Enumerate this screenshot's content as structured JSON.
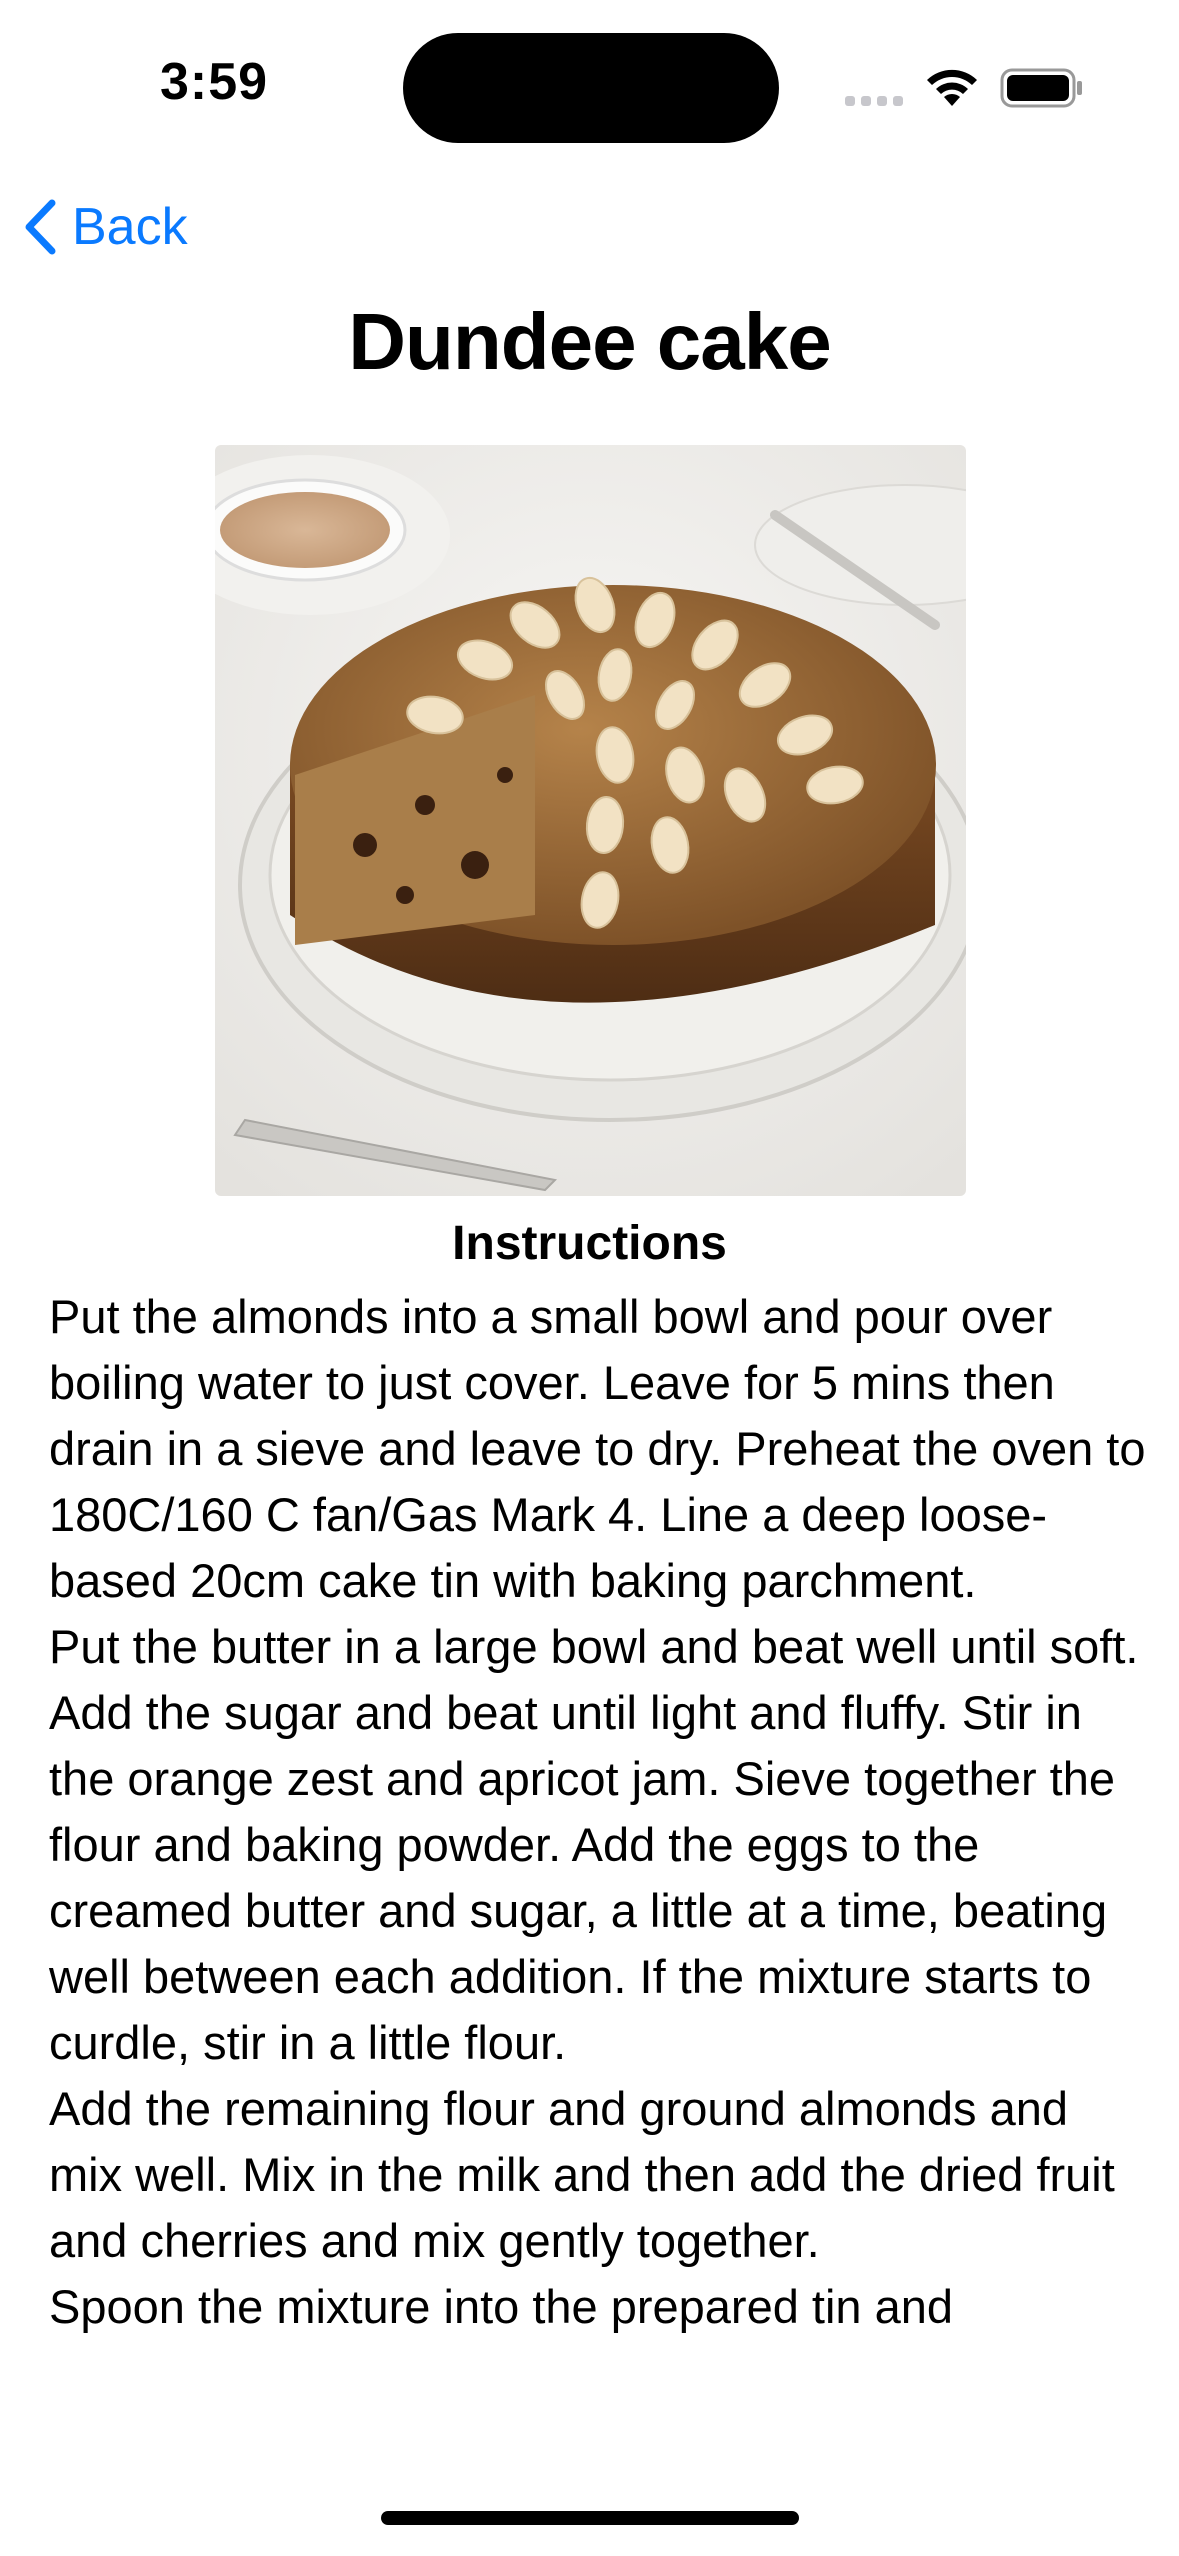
{
  "status_bar": {
    "time": "3:59"
  },
  "nav": {
    "back_label": "Back",
    "title": "Dundee cake"
  },
  "image": {
    "alt": "Dundee cake"
  },
  "instructions": {
    "heading": "Instructions",
    "text": "Put the almonds into a small bowl and pour over boiling water to just cover. Leave for 5 mins then drain in a sieve and leave to dry. Preheat the oven to 180C/160 C fan/Gas Mark 4. Line a deep loose-based 20cm cake tin with baking parchment.\nPut the butter in a large bowl and beat well until soft. Add the sugar and beat until light and fluffy. Stir in the orange zest and apricot jam. Sieve together the flour and baking powder. Add the eggs to the creamed butter and sugar, a little at a time, beating well between each addition. If the mixture starts to curdle, stir in a little flour.\nAdd the remaining flour and ground almonds and mix well. Mix in the milk and then add the dried fruit and cherries and mix gently together.\nSpoon the mixture into the prepared tin and"
  },
  "colors": {
    "accent": "#0a7aff",
    "background": "#ffffff",
    "text": "#000000"
  },
  "icons": [
    "chevron-left-icon",
    "wifi-icon",
    "battery-icon",
    "cellular-signal-icon"
  ]
}
